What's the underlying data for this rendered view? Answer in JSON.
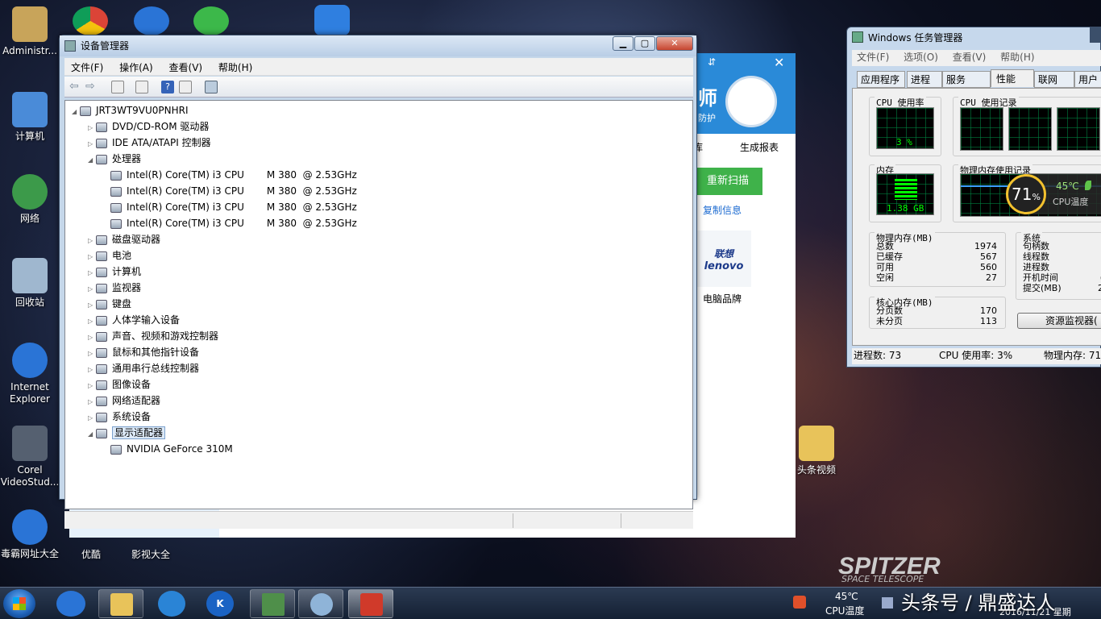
{
  "desktop": {
    "icons": [
      {
        "label": "Administr...",
        "color": "#c8a45a"
      },
      {
        "label": "计算机",
        "color": "#4a8bd8"
      },
      {
        "label": "网络",
        "color": "#3c9a4a"
      },
      {
        "label": "回收站",
        "color": "#9fb7cf"
      },
      {
        "label": "Internet Explorer",
        "color": "#2a74d6"
      },
      {
        "label": "Corel VideoStud...",
        "color": "#556070"
      },
      {
        "label": "毒霸网址大全",
        "color": "#2a74d6"
      },
      {
        "label": "优酷",
        "color": "#2a9ad6"
      },
      {
        "label": "影视大全",
        "color": "#2a74d6"
      },
      {
        "label": "头条视频",
        "color": "#e8c35a"
      }
    ],
    "spitzer_logo": "SPITZER",
    "spitzer_sub": "SPACE TELESCOPE"
  },
  "device_manager": {
    "title": "设备管理器",
    "menu": [
      "文件(F)",
      "操作(A)",
      "查看(V)",
      "帮助(H)"
    ],
    "root": "JRT3WT9VU0PNHRI",
    "nodes": [
      "DVD/CD-ROM 驱动器",
      "IDE ATA/ATAPI 控制器",
      "处理器"
    ],
    "cpus": [
      {
        "name": "Intel(R) Core(TM) i3 CPU",
        "model": "M 380  @ 2.53GHz"
      },
      {
        "name": "Intel(R) Core(TM) i3 CPU",
        "model": "M 380  @ 2.53GHz"
      },
      {
        "name": "Intel(R) Core(TM) i3 CPU",
        "model": "M 380  @ 2.53GHz"
      },
      {
        "name": "Intel(R) Core(TM) i3 CPU",
        "model": "M 380  @ 2.53GHz"
      }
    ],
    "nodes2": [
      "磁盘驱动器",
      "电池",
      "计算机",
      "监视器",
      "键盘",
      "人体学输入设备",
      "声音、视频和游戏控制器",
      "鼠标和其他指针设备",
      "通用串行总线控制器",
      "图像设备",
      "网络适配器",
      "系统设备",
      "显示适配器"
    ],
    "gpu": "NVIDIA GeForce 310M"
  },
  "bg_app": {
    "title_partial": "师",
    "sub_partial": "防护",
    "report_btn": "生成报表",
    "rescan_btn": "重新扫描",
    "copy_link": "复制信息",
    "brand_logo_cn": "联想",
    "brand_logo_en": "lenovo",
    "brand_label": "电脑品牌",
    "tab_partial": "库"
  },
  "task_manager": {
    "title": "Windows 任务管理器",
    "menu": [
      "文件(F)",
      "选项(O)",
      "查看(V)",
      "帮助(H)"
    ],
    "tabs": [
      "应用程序",
      "进程",
      "服务",
      "性能",
      "联网",
      "用户"
    ],
    "active_tab": "性能",
    "cpu_usage_label": "CPU 使用率",
    "cpu_usage_value": "3 %",
    "cpu_history_label": "CPU 使用记录",
    "mem_label": "内存",
    "mem_value": "1.38 GB",
    "mem_history_label": "物理内存使用记录",
    "phys_mem": {
      "title": "物理内存(MB)",
      "rows": [
        [
          "总数",
          "1974"
        ],
        [
          "已缓存",
          "567"
        ],
        [
          "可用",
          "560"
        ],
        [
          "空闲",
          "27"
        ]
      ]
    },
    "kernel_mem": {
      "title": "核心内存(MB)",
      "rows": [
        [
          "分页数",
          "170"
        ],
        [
          "未分页",
          "113"
        ]
      ]
    },
    "system": {
      "title": "系统",
      "rows": [
        "句柄数",
        "线程数",
        "进程数",
        "开机时间",
        "提交(MB)"
      ],
      "partial_values": [
        "",
        "",
        "",
        "(",
        "2"
      ]
    },
    "resource_monitor_btn": "资源监视器(",
    "status": {
      "processes": "进程数: 73",
      "cpu": "CPU 使用率: 3%",
      "memory": "物理内存: 71"
    }
  },
  "temp_widget": {
    "percent": "71",
    "percent_unit": "%",
    "temp": "45℃",
    "label": "CPU温度"
  },
  "taskbar": {
    "tray_temp": "45℃",
    "tray_temp_label": "CPU温度",
    "date": "2016/11/21 星期",
    "watermark": "头条号 / 鼎盛达人"
  }
}
